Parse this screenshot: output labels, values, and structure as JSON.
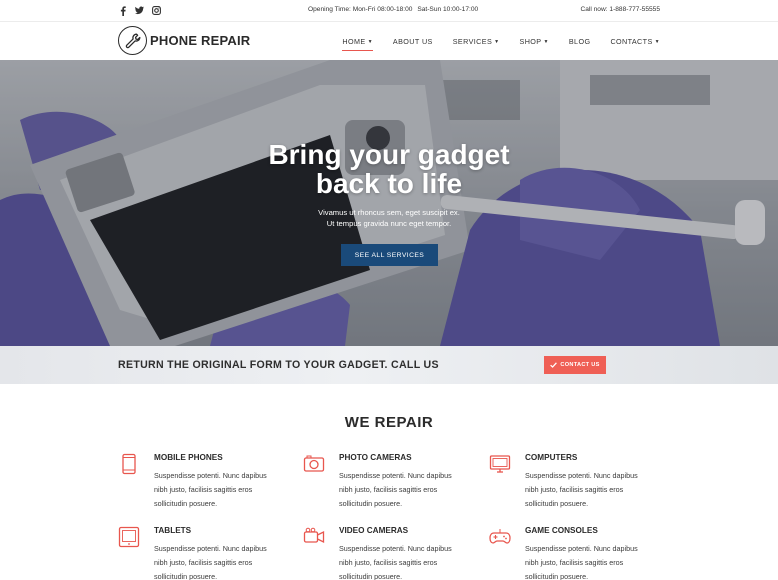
{
  "topbar": {
    "social_icons": [
      "facebook-icon",
      "twitter-icon",
      "instagram-icon"
    ],
    "hours_label": "Opening Time:",
    "hours_weekday": "Mon-Fri 08:00-18:00",
    "hours_weekend": "Sat-Sun 10:00-17:00",
    "call_label": "Call now:",
    "call_number": "1-888-777-55555"
  },
  "header": {
    "logo_icon": "wrench-icon",
    "logo_text": "PHONE REPAIR",
    "nav": [
      {
        "label": "HOME",
        "dropdown": true,
        "active": true
      },
      {
        "label": "ABOUT US",
        "dropdown": false,
        "active": false
      },
      {
        "label": "SERVICES",
        "dropdown": true,
        "active": false
      },
      {
        "label": "SHOP",
        "dropdown": true,
        "active": false
      },
      {
        "label": "BLOG",
        "dropdown": false,
        "active": false
      },
      {
        "label": "CONTACTS",
        "dropdown": true,
        "active": false
      }
    ]
  },
  "hero": {
    "title_line1": "Bring your gadget",
    "title_line2": "back to life",
    "subtitle_line1": "Vivamus ut rhoncus sem, eget suscipit ex.",
    "subtitle_line2": "Ut tempus gravida nunc eget tempor.",
    "button_label": "SEE ALL SERVICES"
  },
  "cta": {
    "text": "RETURN THE ORIGINAL FORM TO YOUR GADGET. CALL US",
    "button_label": "CONTACT US",
    "button_icon": "check-icon"
  },
  "repair": {
    "title": "WE REPAIR",
    "services": [
      {
        "name": "MOBILE PHONES",
        "icon": "mobile-phone-icon",
        "desc": "Suspendisse potenti. Nunc dapibus nibh justo, facilisis sagittis eros sollicitudin posuere."
      },
      {
        "name": "PHOTO CAMERAS",
        "icon": "camera-icon",
        "desc": "Suspendisse potenti. Nunc dapibus nibh justo, facilisis sagittis eros sollicitudin posuere."
      },
      {
        "name": "COMPUTERS",
        "icon": "monitor-icon",
        "desc": "Suspendisse potenti. Nunc dapibus nibh justo, facilisis sagittis eros sollicitudin posuere."
      },
      {
        "name": "TABLETS",
        "icon": "tablet-icon",
        "desc": "Suspendisse potenti. Nunc dapibus nibh justo, facilisis sagittis eros sollicitudin posuere."
      },
      {
        "name": "VIDEO CAMERAS",
        "icon": "video-camera-icon",
        "desc": "Suspendisse potenti. Nunc dapibus nibh justo, facilisis sagittis eros sollicitudin posuere."
      },
      {
        "name": "GAME CONSOLES",
        "icon": "gamepad-icon",
        "desc": "Suspendisse potenti. Nunc dapibus nibh justo, facilisis sagittis eros sollicitudin posuere."
      }
    ]
  },
  "colors": {
    "accent": "#e8564e",
    "primary_button": "#1a4a7a",
    "cta_button": "#ef5f55",
    "text_dark": "#2b2b2b"
  }
}
